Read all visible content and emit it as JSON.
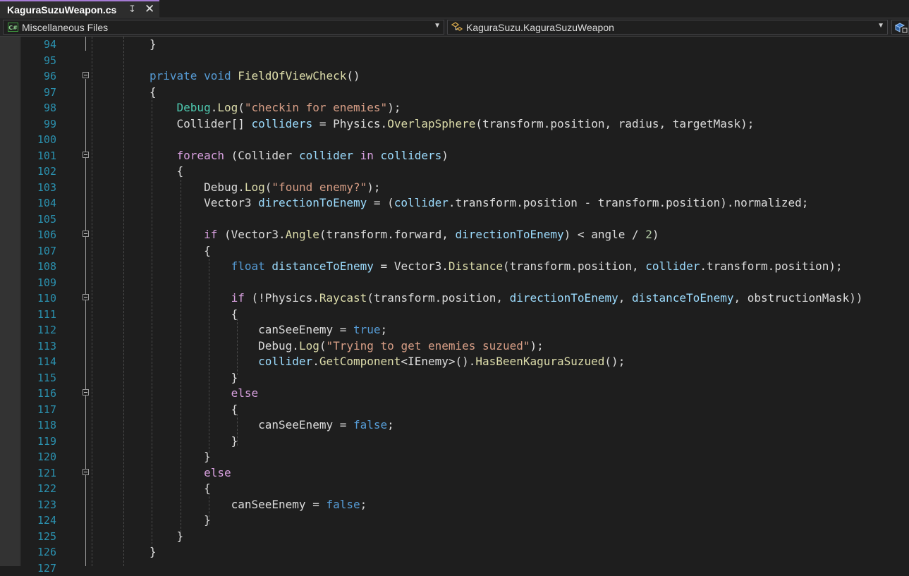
{
  "tab": {
    "title": "KaguraSuzuWeapon.cs",
    "pin": "↧",
    "close": "✕"
  },
  "nav": {
    "project_label": "Miscellaneous Files",
    "cs_badge": "C#",
    "class_label": "KaguraSuzu.KaguraSuzuWeapon"
  },
  "code": {
    "line_numbers": [
      "94",
      "95",
      "96",
      "97",
      "98",
      "99",
      "100",
      "101",
      "102",
      "103",
      "104",
      "105",
      "106",
      "107",
      "108",
      "109",
      "110",
      "111",
      "112",
      "113",
      "114",
      "115",
      "116",
      "117",
      "118",
      "119",
      "120",
      "121",
      "122",
      "123",
      "124",
      "125",
      "126",
      "127"
    ]
  },
  "colors": {
    "keyword": "#569cd6",
    "control": "#d8a0df",
    "string": "#d69d85",
    "method": "#dcdcaa",
    "variable": "#9cdcfe",
    "number": "#b5cea8",
    "line_number": "#2b91af"
  },
  "tokens": {
    "private": "private",
    "void": "void",
    "foreach": "foreach",
    "in": "in",
    "if": "if",
    "else": "else",
    "float": "float",
    "true": "true",
    "false": "false",
    "close_brace": "}",
    "open_brace": "{",
    "FieldOfViewCheck": "FieldOfViewCheck",
    "fov_parens": "()",
    "Debug": "Debug",
    "dot": ".",
    "Log": "Log",
    "lparen": "(",
    "rparen_semi": ");",
    "str_checkin": "\"checkin for enemies\"",
    "str_found": "\"found enemy?\"",
    "str_trying": "\"Trying to get enemies suzued\"",
    "Collider_arr": "Collider[] ",
    "colliders": "colliders",
    "assign": " = ",
    "Physics": "Physics",
    "OverlapSphere": "OverlapSphere",
    "transform": "transform",
    "position": "position",
    "comma_radius_mask": ", radius, targetMask);",
    "foreach_open": " (Collider ",
    "collider": "collider",
    "in_space": " ",
    "rparen": ")",
    "Vector3_sp": "Vector3 ",
    "Vector3": "Vector3",
    "directionToEnemy": "directionToEnemy",
    "assign_lparen": " = (",
    "minus": " - ",
    "normalized": "normalized",
    "rparen_dot": ").",
    "semi": ";",
    "if_open": " (",
    "Angle": "Angle",
    "forward": "forward",
    "comma": ", ",
    "lt_angle_div": ") < angle / ",
    "two": "2",
    "distanceToEnemy": "distanceToEnemy",
    "Distance": "Distance",
    "rparen_semi2": ");",
    "not_lparen": " (!",
    "Raycast": "Raycast",
    "obstruction": ", obstructionMask))",
    "canSeeEnemy": "canSeeEnemy",
    "assign_eq": " = ",
    "GetComponent": "GetComponent",
    "generic": "<IEnemy>",
    "parens_dot": "().",
    "HasBeenKaguraSuzued": "HasBeenKaguraSuzued",
    "parens_semi": "();"
  }
}
